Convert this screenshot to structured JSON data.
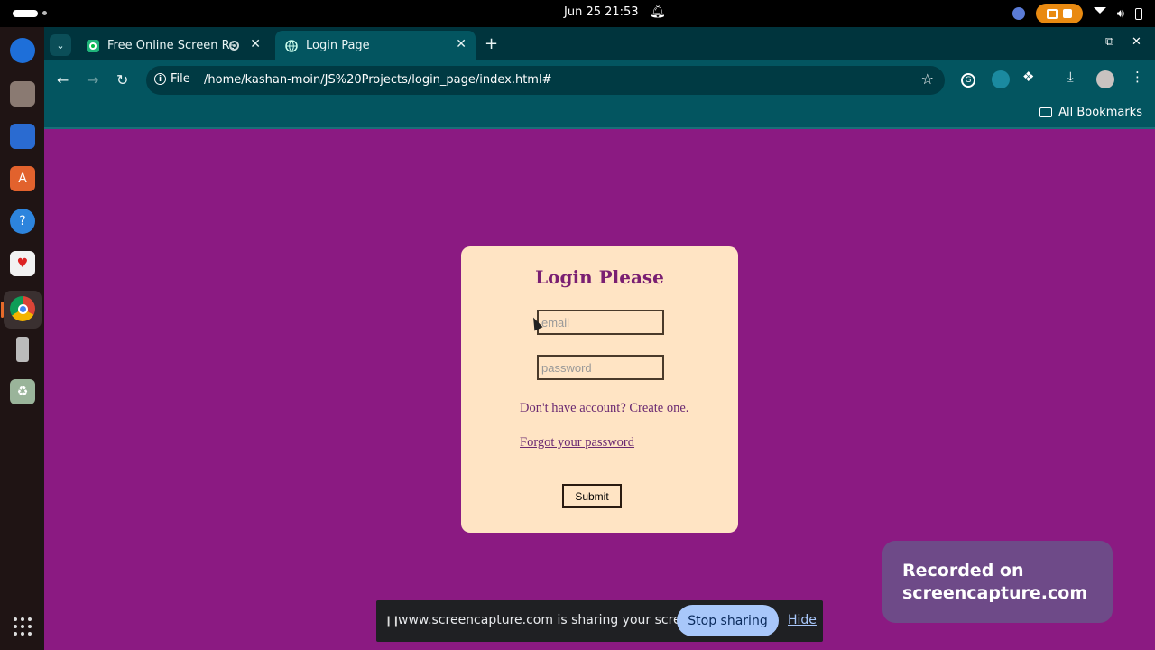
{
  "system": {
    "clock": "Jun 25  21:53"
  },
  "browser": {
    "tabs": [
      {
        "title": "Free Online Screen Re"
      },
      {
        "title": "Login Page"
      }
    ],
    "address": {
      "scheme_label": "File",
      "url": "/home/kashan-moin/JS%20Projects/login_page/index.html#"
    },
    "bookmarks_label": "All Bookmarks"
  },
  "login": {
    "heading": "Login Please",
    "email_placeholder": "email",
    "password_placeholder": "password",
    "create_link": "Don't have account? Create one.",
    "forgot_link": "Forgot your password",
    "submit_label": "Submit"
  },
  "share_bar": {
    "message": "www.screencapture.com is sharing your screen.",
    "stop_label": "Stop sharing",
    "hide_label": "Hide"
  },
  "watermark": {
    "line1": "Recorded on",
    "line2": "screencapture.com"
  },
  "colors": {
    "page_bg": "#8b1a82",
    "card_bg": "#ffe4c4",
    "browser_frame": "#035560"
  }
}
